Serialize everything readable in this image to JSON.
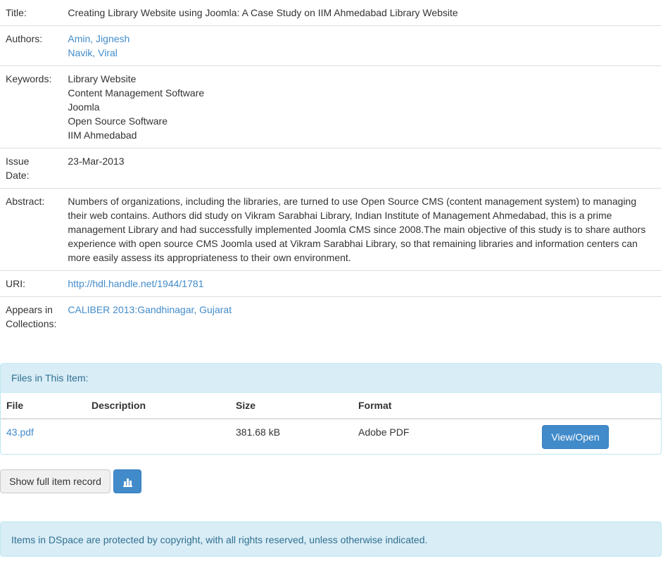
{
  "item": {
    "title_label": "Title:",
    "title_value": "Creating Library Website using Joomla: A Case Study on IIM Ahmedabad Library Website",
    "authors_label": "Authors:",
    "authors": [
      "Amin, Jignesh",
      "Navik, Viral"
    ],
    "keywords_label": "Keywords:",
    "keywords": [
      "Library Website",
      "Content Management Software",
      "Joomla",
      "Open Source Software",
      "IIM Ahmedabad"
    ],
    "issue_date_label_1": "Issue",
    "issue_date_label_2": "Date:",
    "issue_date_value": "23-Mar-2013",
    "abstract_label": "Abstract:",
    "abstract_lines": [
      "Numbers of organizations, including the libraries, are turned to use Open Source CMS (content management system) to managing",
      "their web contains. Authors did study on Vikram Sarabhai Library, Indian Institute of Management Ahmedabad, this is a prime",
      "management Library and had successfully implemented Joomla CMS since 2008.The main objective of this study is to share authors",
      "experience with open source CMS Joomla used at Vikram Sarabhai Library, so that remaining libraries and information centers can",
      "more easily assess its appropriateness to their own environment."
    ],
    "uri_label": "URI:",
    "uri_value": "http://hdl.handle.net/1944/1781",
    "collections_label_1": "Appears in",
    "collections_label_2": "Collections:",
    "collections_value": "CALIBER 2013:Gandhinagar, Gujarat"
  },
  "files": {
    "heading": "Files in This Item:",
    "columns": {
      "file": "File",
      "description": "Description",
      "size": "Size",
      "format": "Format"
    },
    "rows": [
      {
        "file": "43.pdf",
        "description": "",
        "size": "381.68 kB",
        "format": "Adobe PDF",
        "action": "View/Open"
      }
    ]
  },
  "actions": {
    "show_full_label": "Show full item record",
    "stats_icon": "bar-chart-icon"
  },
  "footer": {
    "notice": "Items in DSpace are protected by copyright, with all rights reserved, unless otherwise indicated."
  },
  "colors": {
    "link": "#428bca",
    "info_bg": "#d9edf7",
    "info_border": "#bce8f1",
    "info_text": "#31708f",
    "primary": "#428bca"
  }
}
